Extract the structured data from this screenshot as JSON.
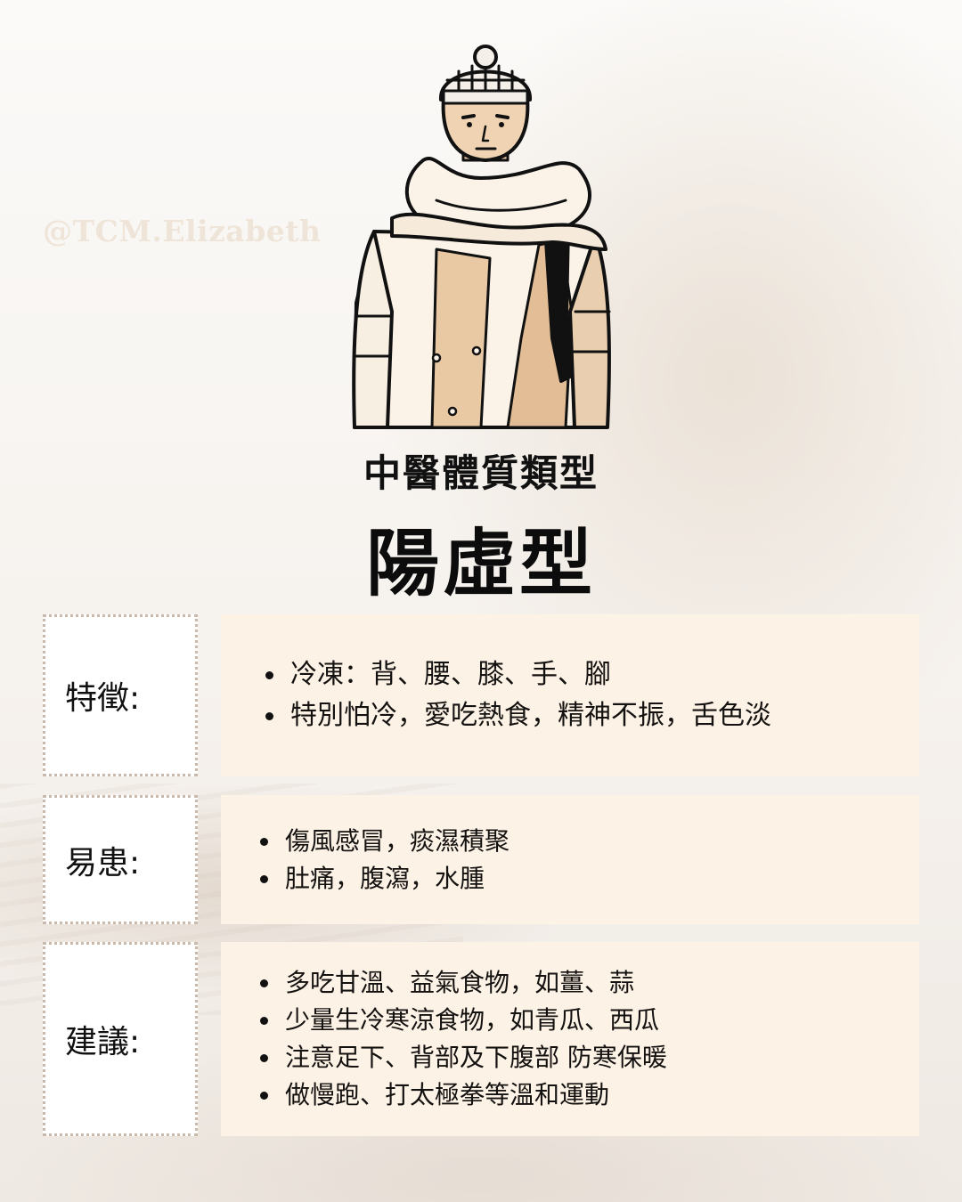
{
  "watermark": "@TCM.Elizabeth",
  "heading": "中醫體質類型",
  "title": "陽虛型",
  "colors": {
    "label_border": "#c9b9aa",
    "content_bg": "#fdf2e6",
    "watermark": "#efe4d8"
  },
  "illustration": {
    "name": "man-in-winter-coat-hat-scarf-illustration"
  },
  "sections": [
    {
      "label": "特徵:",
      "items": [
        "冷凍：背、腰、膝、手、腳",
        "特別怕冷，愛吃熱食，精神不振，舌色淡"
      ]
    },
    {
      "label": "易患:",
      "items": [
        "傷風感冒，痰濕積聚",
        "肚痛，腹瀉，水腫"
      ]
    },
    {
      "label": "建議:",
      "items": [
        "多吃甘溫、益氣食物，如薑、蒜",
        "少量生冷寒涼食物，如青瓜、西瓜",
        "注意足下、背部及下腹部 防寒保暖",
        "做慢跑、打太極拳等溫和運動"
      ]
    }
  ]
}
